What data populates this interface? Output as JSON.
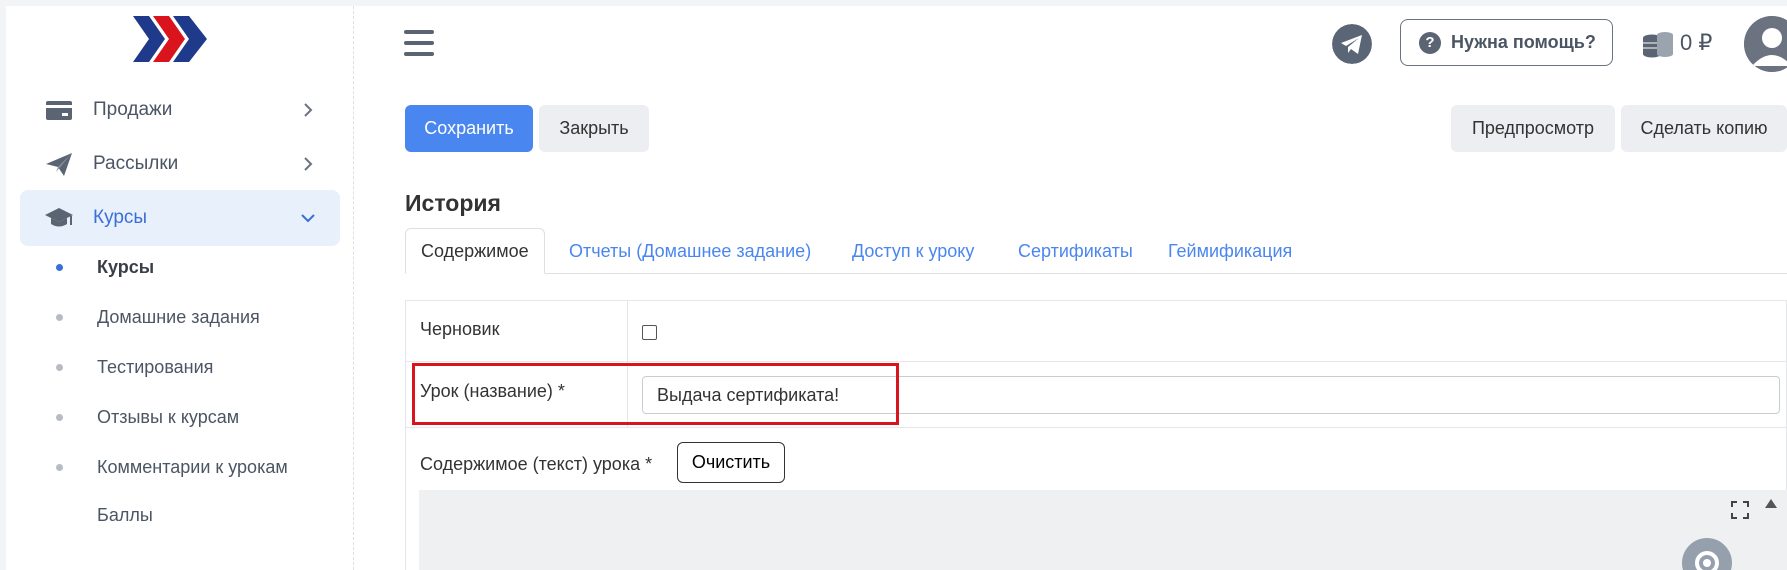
{
  "sidebar": {
    "nav": [
      {
        "label": "Продажи",
        "icon": "credit-card-icon"
      },
      {
        "label": "Рассылки",
        "icon": "paper-plane-icon"
      },
      {
        "label": "Курсы",
        "icon": "graduation-cap-icon",
        "active": true
      }
    ],
    "sub_items": [
      {
        "label": "Курсы",
        "current": true
      },
      {
        "label": "Домашние задания"
      },
      {
        "label": "Тестирования"
      },
      {
        "label": "Отзывы к курсам"
      },
      {
        "label": "Комментарии к урокам"
      },
      {
        "label": "Баллы"
      }
    ]
  },
  "header": {
    "help_label": "Нужна помощь?",
    "help_icon_text": "?",
    "balance": "0 ₽"
  },
  "toolbar": {
    "save_label": "Сохранить",
    "close_label": "Закрыть",
    "preview_label": "Предпросмотр",
    "copy_label": "Сделать копию"
  },
  "page": {
    "title": "История"
  },
  "tabs": [
    {
      "label": "Содержимое",
      "active": true
    },
    {
      "label": "Отчеты (Домашнее задание)"
    },
    {
      "label": "Доступ к уроку"
    },
    {
      "label": "Сертификаты"
    },
    {
      "label": "Геймификация"
    }
  ],
  "form": {
    "draft_label": "Черновик",
    "draft_checked": false,
    "lesson_name_label": "Урок (название) *",
    "lesson_name_value": "Выдача сертификата!",
    "content_label": "Содержимое (текст) урока *",
    "clear_label": "Очистить"
  },
  "colors": {
    "primary": "#4a86f0",
    "active_nav_bg": "#e8f0fc",
    "highlight": "#d9141c"
  }
}
